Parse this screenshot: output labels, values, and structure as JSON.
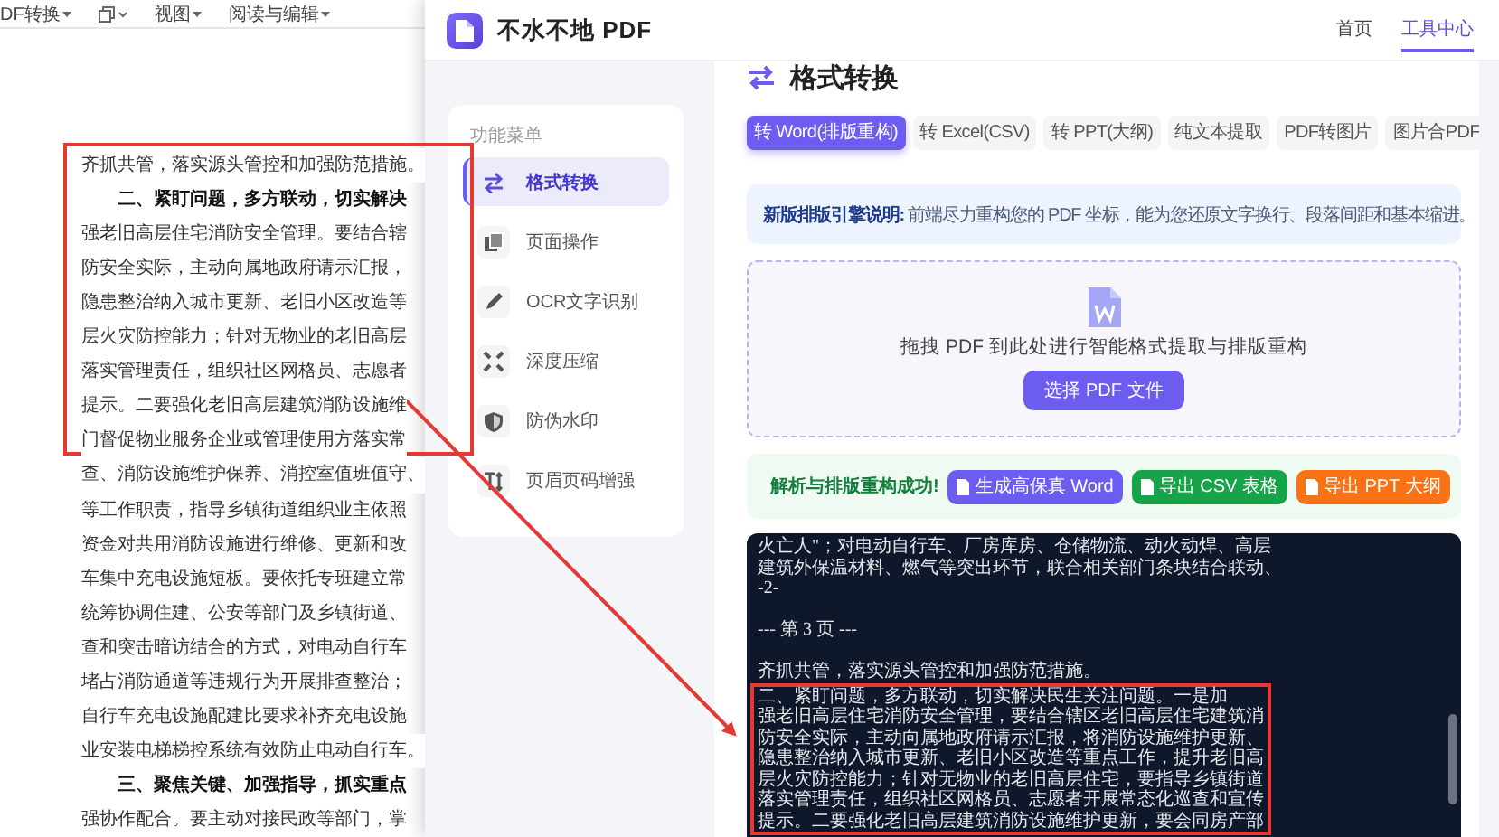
{
  "doc_toolbar": {
    "items": [
      "DF转换",
      "视图",
      "阅读与编辑"
    ]
  },
  "document": {
    "lines": [
      {
        "kind": "body",
        "text": "齐抓共管，落实源头管控和加强防范措施。"
      },
      {
        "kind": "heading",
        "text": "二、紧盯问题，多方联动，切实解决"
      },
      {
        "kind": "body",
        "text": "强老旧高层住宅消防安全管理。要结合辖"
      },
      {
        "kind": "body",
        "text": "防安全实际，主动向属地政府请示汇报，"
      },
      {
        "kind": "body",
        "text": "隐患整治纳入城市更新、老旧小区改造等"
      },
      {
        "kind": "body",
        "text": "层火灾防控能力；针对无物业的老旧高层"
      },
      {
        "kind": "body",
        "text": "落实管理责任，组织社区网格员、志愿者"
      },
      {
        "kind": "body",
        "text": "提示。二要强化老旧高层建筑消防设施维"
      },
      {
        "kind": "body",
        "text": "门督促物业服务企业或管理使用方落实常"
      },
      {
        "kind": "body",
        "text": "查、消防设施维护保养、消控室值班值守、"
      },
      {
        "kind": "body",
        "text": "等工作职责，指导乡镇街道组织业主依照"
      },
      {
        "kind": "body",
        "text": "资金对共用消防设施进行维修、更新和改"
      },
      {
        "kind": "body",
        "text": "车集中充电设施短板。要依托专班建立常"
      },
      {
        "kind": "body",
        "text": "统筹协调住建、公安等部门及乡镇街道、"
      },
      {
        "kind": "body",
        "text": "查和突击暗访结合的方式，对电动自行车"
      },
      {
        "kind": "body",
        "text": "堵占消防通道等违规行为开展排查整治；"
      },
      {
        "kind": "body",
        "text": "自行车充电设施配建比要求补齐充电设施"
      },
      {
        "kind": "body",
        "text": "业安装电梯梯控系统有效防止电动自行车。"
      },
      {
        "kind": "heading",
        "text": "三、聚焦关键、加强指导，抓实重点"
      },
      {
        "kind": "body",
        "text": "强协作配合。要主动对接民政等部门，掌"
      }
    ]
  },
  "app": {
    "title": "不水不地 PDF",
    "nav": [
      {
        "label": "首页",
        "selected": false
      },
      {
        "label": "工具中心",
        "selected": true
      }
    ]
  },
  "sidebar": {
    "heading": "功能菜单",
    "items": [
      {
        "label": "格式转换",
        "kind": "swap",
        "selected": true
      },
      {
        "label": "页面操作",
        "kind": "pages",
        "selected": false
      },
      {
        "label": "OCR文字识别",
        "kind": "pen",
        "selected": false
      },
      {
        "label": "深度压缩",
        "kind": "compress",
        "selected": false
      },
      {
        "label": "防伪水印",
        "kind": "shield",
        "selected": false
      },
      {
        "label": "页眉页码增强",
        "kind": "heading",
        "selected": false
      }
    ]
  },
  "main": {
    "title": "格式转换",
    "tabs": [
      {
        "label": "转 Word(排版重构)",
        "selected": true
      },
      {
        "label": "转 Excel(CSV)",
        "selected": false
      },
      {
        "label": "转 PPT(大纲)",
        "selected": false
      },
      {
        "label": "纯文本提取",
        "selected": false
      },
      {
        "label": "PDF转图片",
        "selected": false
      },
      {
        "label": "图片合PDF",
        "selected": false
      }
    ],
    "notice": {
      "label": "新版排版引擎说明:",
      "text": "前端尽力重构您的 PDF 坐标，能为您还原文字换行、段落间距和基本缩进。"
    },
    "dropzone": {
      "text": "拖拽 PDF 到此处进行智能格式提取与排版重构",
      "button": "选择 PDF 文件"
    },
    "result": {
      "message": "解析与排版重构成功!",
      "actions": [
        {
          "label": "生成高保真 Word",
          "color": "#6d5cf0"
        },
        {
          "label": "导出 CSV 表格",
          "color": "#16a34a"
        },
        {
          "label": "导出 PPT 大纲",
          "color": "#f97316"
        }
      ]
    },
    "output": {
      "blocks": [
        {
          "highlighted": false,
          "lines": [
            {
              "kind": "text",
              "text": "火亡人\"；对电动自行车、厂房库房、仓储物流、动火动焊、高层"
            },
            {
              "kind": "text",
              "text": "建筑外保温材料、燃气等突出环节，联合相关部门条块结合联动、"
            },
            {
              "kind": "text",
              "text": "-2-"
            },
            {
              "kind": "gap"
            },
            {
              "kind": "text",
              "text": "--- 第 3 页 ---"
            },
            {
              "kind": "gap"
            },
            {
              "kind": "text",
              "text": "齐抓共管，落实源头管控和加强防范措施。"
            }
          ]
        },
        {
          "highlighted": true,
          "lines": [
            {
              "kind": "text",
              "text": "二、紧盯问题，多方联动，切实解决民生关注问题。一是加"
            },
            {
              "kind": "text",
              "text": "强老旧高层住宅消防安全管理，要结合辖区老旧高层住宅建筑消"
            },
            {
              "kind": "text",
              "text": "防安全实际，主动向属地政府请示汇报，将消防设施维护更新、"
            },
            {
              "kind": "text",
              "text": "隐患整治纳入城市更新、老旧小区改造等重点工作，提升老旧高"
            },
            {
              "kind": "text",
              "text": "层火灾防控能力；针对无物业的老旧高层住宅，要指导乡镇街道"
            },
            {
              "kind": "text",
              "text": "落实管理责任，组织社区网格员、志愿者开展常态化巡查和宣传"
            },
            {
              "kind": "text",
              "text": "提示。二要强化老旧高层建筑消防设施维护更新，要会同房产部"
            }
          ]
        }
      ]
    }
  }
}
